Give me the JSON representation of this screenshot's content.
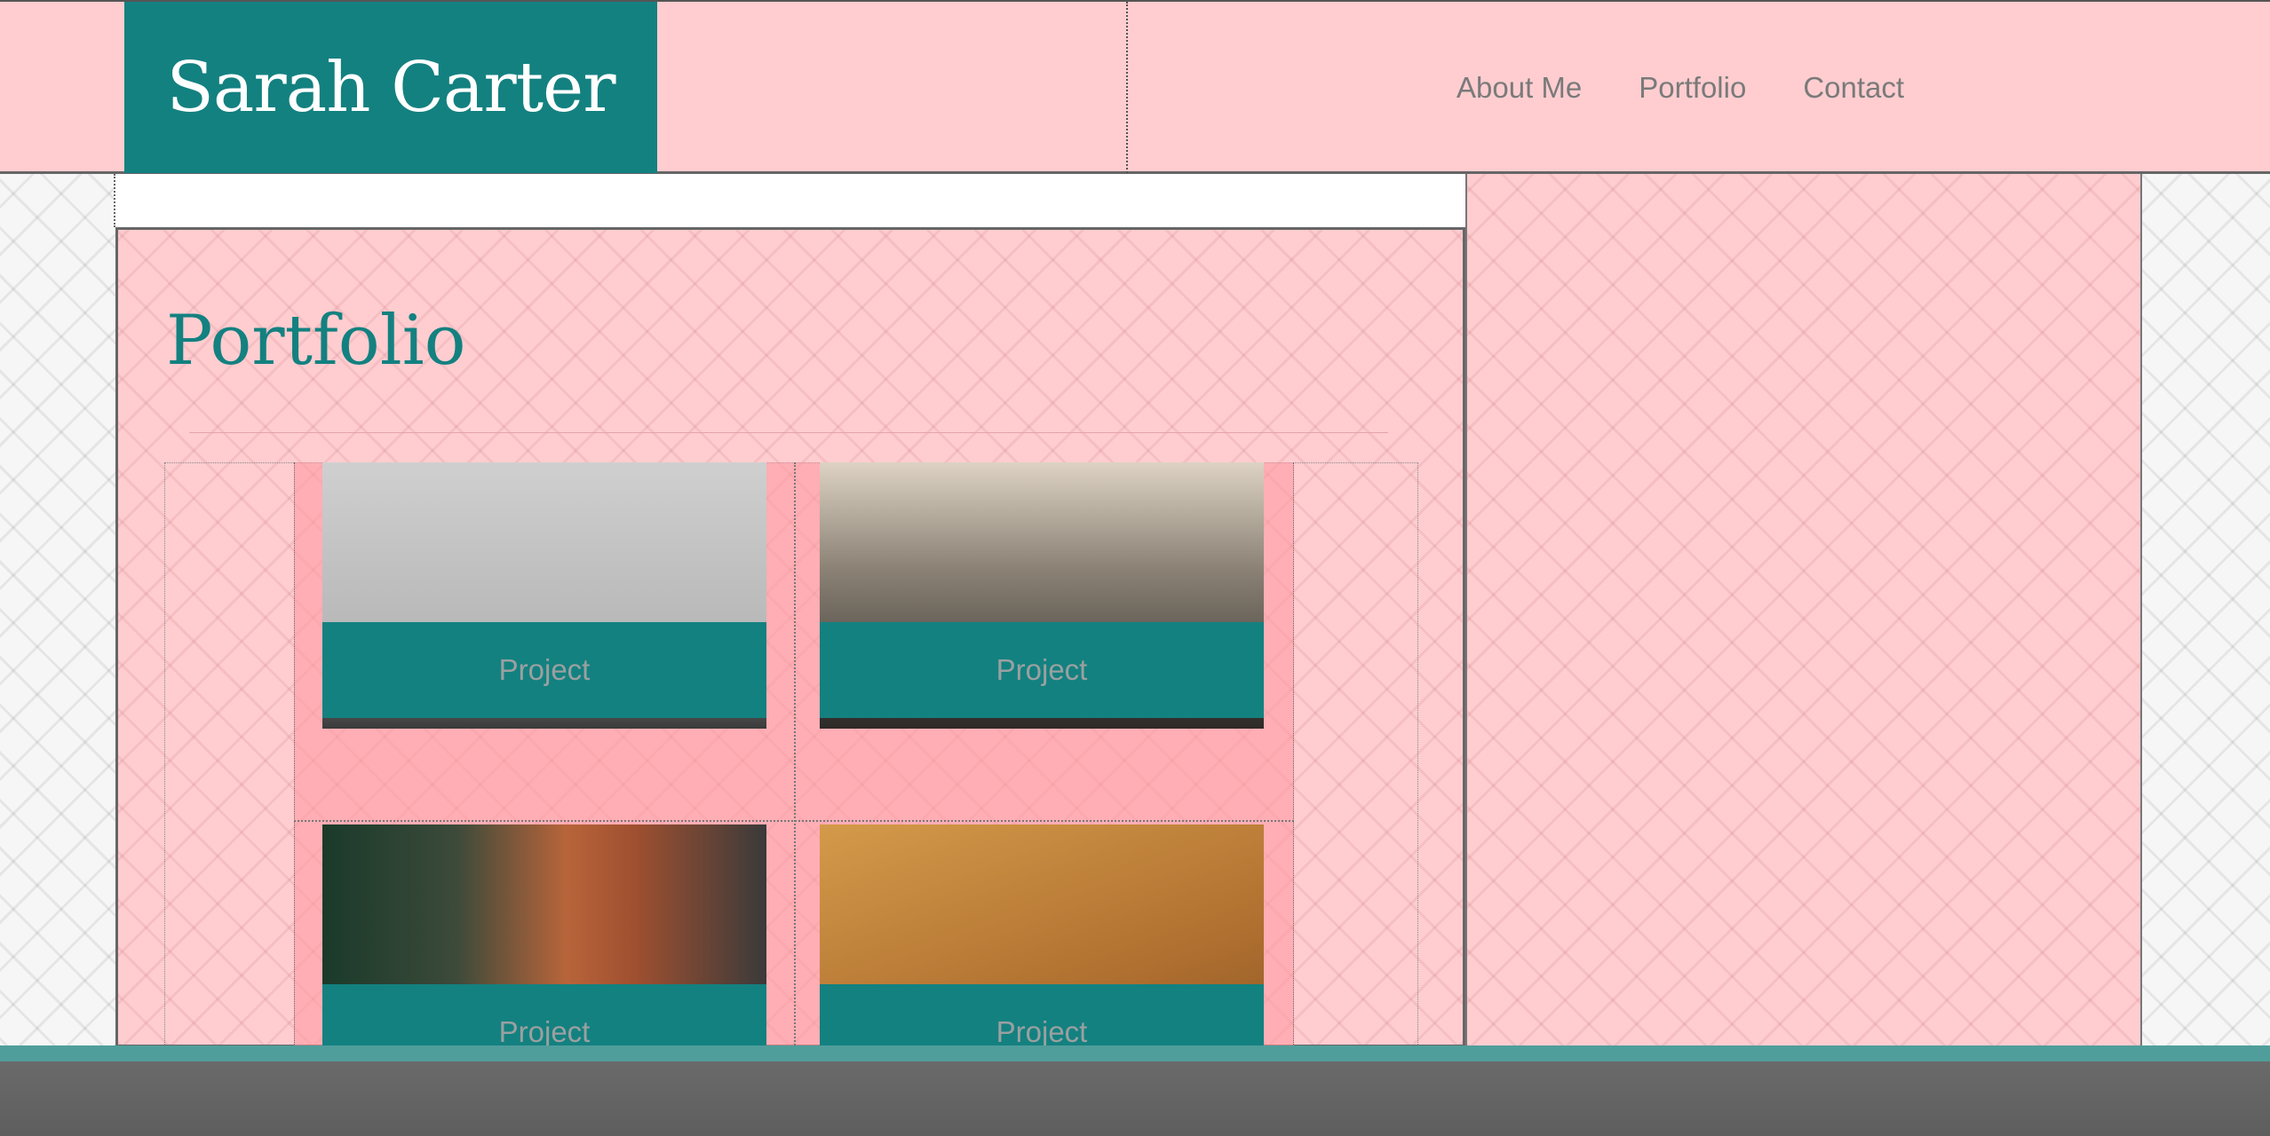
{
  "header": {
    "brand_name": "Sarah Carter",
    "nav": [
      "About Me",
      "Portfolio",
      "Contact"
    ]
  },
  "main": {
    "title": "Portfolio",
    "projects": [
      {
        "label": "Project",
        "image": "tablet-photo"
      },
      {
        "label": "Project",
        "image": "keyboard-headphones-photo"
      },
      {
        "label": "Project",
        "image": "copper-coil-photo"
      },
      {
        "label": "Project",
        "image": "phone-earphones-photo"
      }
    ]
  },
  "colors": {
    "brand_teal": "#138180",
    "header_pink": "#ffcdd0",
    "footer_accent": "#4f9e9b",
    "footer": "#646464",
    "nav_text": "#7a7a7a"
  }
}
